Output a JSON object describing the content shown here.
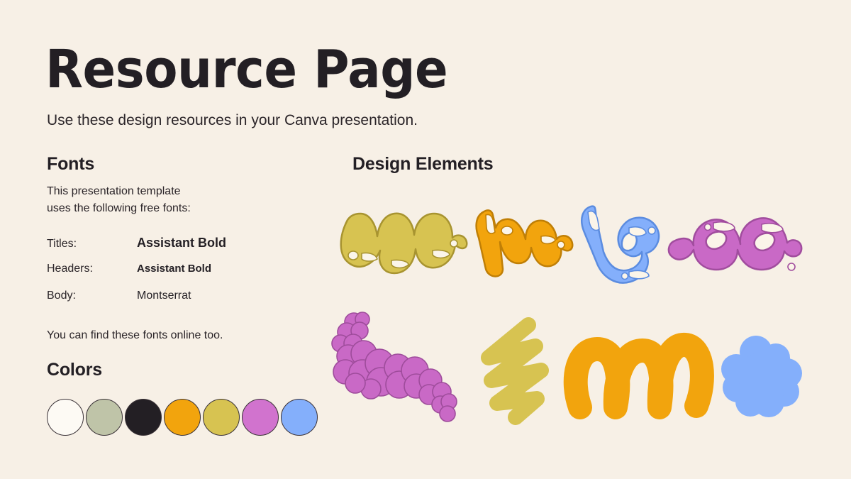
{
  "slide": {
    "background_color": "#F7F0E6",
    "title": "Resource Page",
    "subtitle": "Use these design resources in your Canva presentation."
  },
  "fonts_section": {
    "heading": "Fonts",
    "intro_line1": "This presentation template",
    "intro_line2": "uses the following free fonts:",
    "rows": [
      {
        "label": "Titles:",
        "value": "Assistant Bold"
      },
      {
        "label": "Headers:",
        "value": "Assistant Bold"
      },
      {
        "label": "Body:",
        "value": "Montserrat"
      }
    ],
    "footer": "You can find these fonts online too."
  },
  "colors_section": {
    "heading": "Colors",
    "swatches": [
      {
        "name": "swatch-white",
        "hex": "#FDFAF4"
      },
      {
        "name": "swatch-sage",
        "hex": "#BFC4A8"
      },
      {
        "name": "swatch-black",
        "hex": "#231F24"
      },
      {
        "name": "swatch-orange",
        "hex": "#F2A40D"
      },
      {
        "name": "swatch-yellow",
        "hex": "#D7C351"
      },
      {
        "name": "swatch-orchid",
        "hex": "#D173CE"
      },
      {
        "name": "swatch-blue",
        "hex": "#84AFFB"
      }
    ]
  },
  "elements_section": {
    "heading": "Design Elements",
    "doodles": [
      {
        "name": "bubble-letters-yellow",
        "color": "#D7C351",
        "outline": "#A89430",
        "style": "bubble-script"
      },
      {
        "name": "bubble-letters-orange",
        "color": "#F2A40D",
        "outline": "#C07F06",
        "style": "bubble-script"
      },
      {
        "name": "bubble-letter-blue",
        "color": "#84AFFB",
        "outline": "#5B8CE0",
        "style": "bubble-script"
      },
      {
        "name": "bubble-letters-orchid",
        "color": "#C969C6",
        "outline": "#A14D9E",
        "style": "bubble-script"
      },
      {
        "name": "bubble-cluster-orchid",
        "color": "#C969C6",
        "outline": "#9E4C9B",
        "style": "cloud-cluster"
      },
      {
        "name": "zigzag-scribble-yellow",
        "color": "#D7C351",
        "outline": "none",
        "style": "scribble"
      },
      {
        "name": "wave-arches-orange",
        "color": "#F2A40D",
        "outline": "none",
        "style": "arches"
      },
      {
        "name": "cloud-blob-blue",
        "color": "#84AFFB",
        "outline": "none",
        "style": "cloud"
      }
    ]
  }
}
